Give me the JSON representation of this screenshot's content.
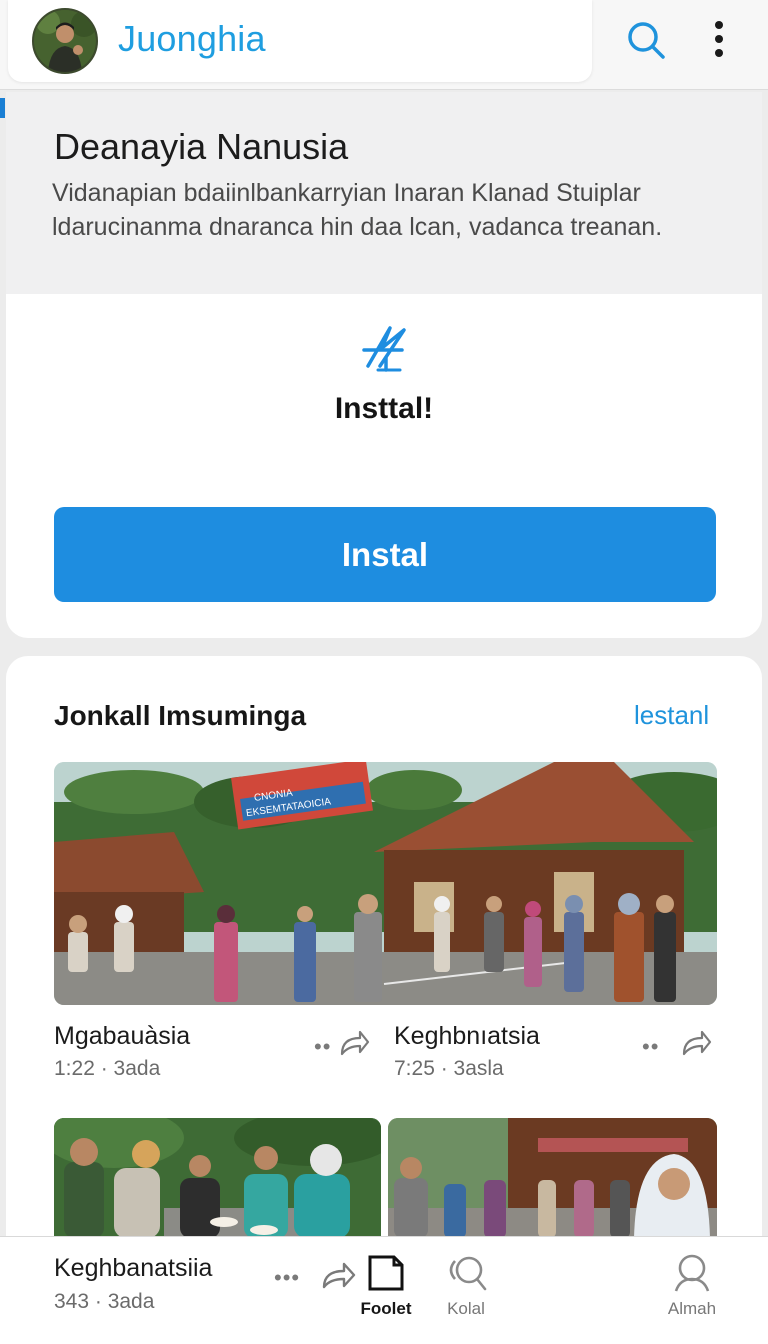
{
  "header": {
    "title": "Juonghia",
    "title_color": "#1f9ee0"
  },
  "hero": {
    "title": "Deanayia Nanusia",
    "description": "Vidanapian bdaiinlbankarryian Inaran Klanad Stuiplar ldarucinanma dnaranca hin daa lcan, vadanca treanan."
  },
  "install": {
    "heading": "Insttal!",
    "button_label": "Instal",
    "icon": "brand-logo-icon",
    "accent_color": "#1e8de0"
  },
  "videos": {
    "section_title": "Jonkall Imsuminga",
    "section_link": "lestanl",
    "items": [
      {
        "title": "Mgabauàsia",
        "meta": "1:22 · 3ada"
      },
      {
        "title": "Keghbnıatsia",
        "meta": "7:25 · 3asla"
      },
      {
        "title": "Keghbanatsiia",
        "meta": "343 · 3ada"
      }
    ],
    "more_glyph": "••"
  },
  "banner_text": {
    "line1": "CNONIA",
    "line2": "EKSEMTATAOICIA"
  },
  "bottom_nav": [
    {
      "label": "Foolet",
      "icon": "bookmark-icon",
      "active": true
    },
    {
      "label": "Kolal",
      "icon": "search-icon",
      "active": false
    },
    {
      "label": "Almah",
      "icon": "profile-icon",
      "active": false
    }
  ]
}
